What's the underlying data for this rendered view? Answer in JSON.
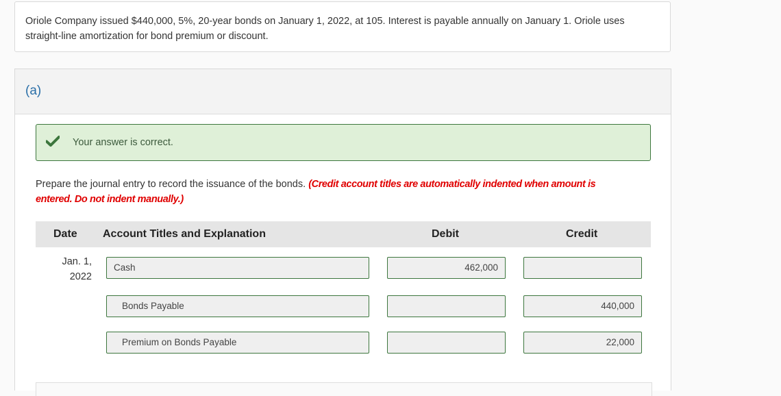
{
  "question": {
    "text": "Oriole Company issued $440,000, 5%, 20-year bonds on January 1, 2022, at 105. Interest is payable annually on January 1. Oriole uses straight-line amortization for bond premium or discount."
  },
  "part": {
    "label": "(a)",
    "feedback": {
      "icon": "check-icon",
      "text": "Your answer is correct.",
      "color": "#3c763d"
    },
    "instructions": {
      "text": "Prepare the journal entry to record the issuance of the bonds. ",
      "note": "(Credit account titles are automatically indented when amount is entered. Do not indent manually.)"
    },
    "table": {
      "headers": {
        "date": "Date",
        "account": "Account Titles and Explanation",
        "debit": "Debit",
        "credit": "Credit"
      },
      "date": {
        "line1": "Jan. 1,",
        "line2": "2022"
      },
      "rows": [
        {
          "account": "Cash",
          "debit": "462,000",
          "credit": ""
        },
        {
          "account": "Bonds Payable",
          "debit": "",
          "credit": "440,000"
        },
        {
          "account": "Premium on Bonds Payable",
          "debit": "",
          "credit": "22,000"
        }
      ]
    }
  }
}
